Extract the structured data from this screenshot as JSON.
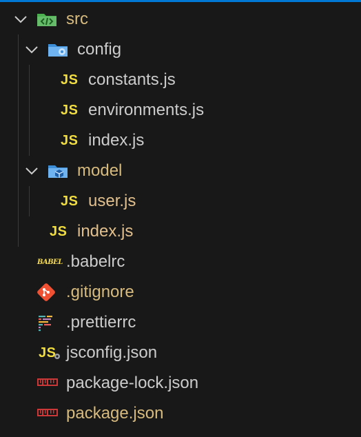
{
  "explorer": {
    "accent": "#0078d4",
    "items": [
      {
        "label": "src",
        "kind": "folder",
        "expanded": true,
        "icon": "folder-src-icon"
      },
      {
        "label": "config",
        "kind": "folder",
        "expanded": true,
        "icon": "folder-config-icon"
      },
      {
        "label": "constants.js",
        "kind": "file",
        "icon": "js-icon"
      },
      {
        "label": "environments.js",
        "kind": "file",
        "icon": "js-icon"
      },
      {
        "label": "index.js",
        "kind": "file",
        "icon": "js-icon"
      },
      {
        "label": "model",
        "kind": "folder",
        "expanded": true,
        "icon": "folder-model-icon"
      },
      {
        "label": "user.js",
        "kind": "file",
        "icon": "js-icon"
      },
      {
        "label": "index.js",
        "kind": "file",
        "icon": "js-icon"
      },
      {
        "label": ".babelrc",
        "kind": "file",
        "icon": "babel-icon",
        "icon_text": "BABEL"
      },
      {
        "label": ".gitignore",
        "kind": "file",
        "icon": "git-icon"
      },
      {
        "label": ".prettierrc",
        "kind": "file",
        "icon": "prettier-icon"
      },
      {
        "label": "jsconfig.json",
        "kind": "file",
        "icon": "jsconfig-icon",
        "icon_text": "JS"
      },
      {
        "label": "package-lock.json",
        "kind": "file",
        "icon": "npm-icon"
      },
      {
        "label": "package.json",
        "kind": "file",
        "icon": "npm-icon"
      }
    ],
    "js_icon_text": "JS",
    "colors": {
      "background": "#181818",
      "text": "#cccccc",
      "modified_text": "#d7ba7d",
      "js_icon": "#f1dd3f",
      "npm_icon": "#cb3837",
      "git_icon": "#f05133",
      "folder_src": "#4caf50",
      "folder_blue": "#42a5f5"
    }
  }
}
